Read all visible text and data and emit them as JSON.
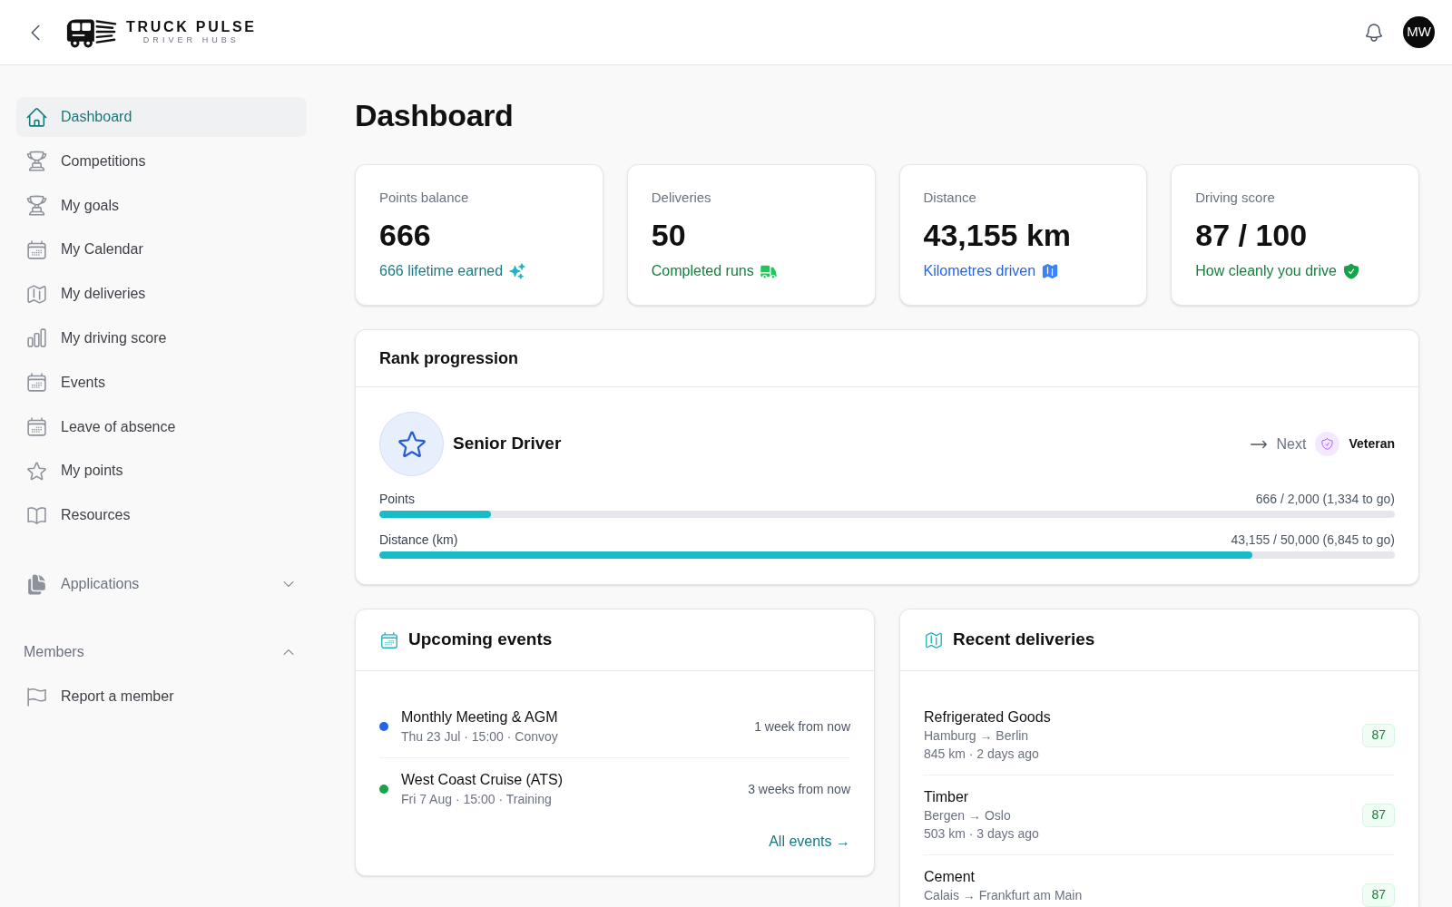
{
  "header": {
    "logo": {
      "title": "TRUCK PULSE",
      "subtitle": "DRIVER HUBS"
    },
    "avatar_initials": "MW"
  },
  "sidebar": {
    "items": [
      {
        "label": "Dashboard",
        "selected": true
      },
      {
        "label": "Competitions",
        "selected": false
      },
      {
        "label": "My goals",
        "selected": false
      },
      {
        "label": "My Calendar",
        "selected": false
      },
      {
        "label": "My deliveries",
        "selected": false
      },
      {
        "label": "My driving score",
        "selected": false
      },
      {
        "label": "Events",
        "selected": false
      },
      {
        "label": "Leave of absence",
        "selected": false
      },
      {
        "label": "My points",
        "selected": false
      },
      {
        "label": "Resources",
        "selected": false
      }
    ],
    "applications": {
      "label": "Applications",
      "expanded": false
    },
    "members": {
      "label": "Members",
      "expanded": true,
      "items": [
        {
          "label": "Report a member",
          "selected": false
        }
      ]
    }
  },
  "page_title": "Dashboard",
  "stats": [
    {
      "label": "Points balance",
      "value": "666",
      "note": "666 lifetime earned",
      "color": "#1b7c85"
    },
    {
      "label": "Deliveries",
      "value": "50",
      "note": "Completed runs",
      "color": "#15803d"
    },
    {
      "label": "Distance",
      "value": "43,155 km",
      "note": "Kilometres driven",
      "color": "#2563eb"
    },
    {
      "label": "Driving score",
      "value": "87 / 100",
      "note": "How cleanly you drive",
      "color": "#15803d"
    }
  ],
  "rank": {
    "title": "Rank progression",
    "current": "Senior Driver",
    "next_label": "Next",
    "next_rank": "Veteran",
    "progress": [
      {
        "label": "Points",
        "reading": "666 / 2,000 (1,334 to go)",
        "level": 0.11
      },
      {
        "label": "Distance (km)",
        "reading": "43,155 / 50,000 (6,845 to go)",
        "level": 0.86
      }
    ]
  },
  "events": {
    "title": "Upcoming events",
    "items": [
      {
        "title": "Monthly Meeting & AGM",
        "details": "Thu 23 Jul · 15:00 · Convoy",
        "when": "1 week from now",
        "color": "#2563eb"
      },
      {
        "title": "West Coast Cruise (ATS)",
        "details": "Fri 7 Aug · 15:00 · Training",
        "when": "3 weeks from now",
        "color": "#16a34a"
      }
    ],
    "link": "All events →"
  },
  "deliveries": {
    "title": "Recent deliveries",
    "items": [
      {
        "cargo": "Refrigerated Goods",
        "route": "Hamburg → Berlin",
        "meta": "845 km · 2 days ago",
        "score": "87"
      },
      {
        "cargo": "Timber",
        "route": "Bergen → Oslo",
        "meta": "503 km · 3 days ago",
        "score": "87"
      },
      {
        "cargo": "Cement",
        "route": "Calais → Frankfurt am Main",
        "score": "87"
      }
    ]
  }
}
